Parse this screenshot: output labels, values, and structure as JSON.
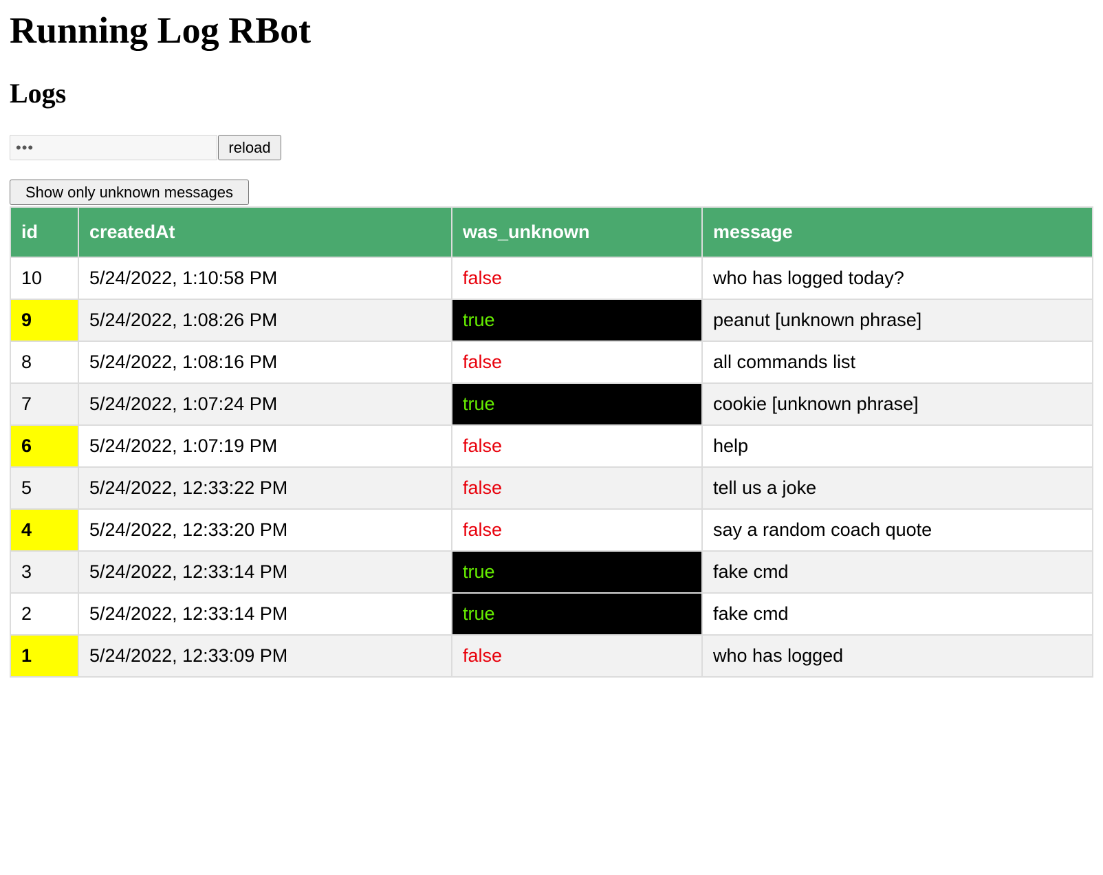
{
  "page": {
    "title": "Running Log RBot",
    "subtitle": "Logs"
  },
  "controls": {
    "password_value": "•••",
    "reload_label": "reload",
    "filter_label": "Show only unknown messages"
  },
  "colors": {
    "header_bg": "#4aa96e",
    "highlight_id_bg": "#ffff00",
    "unknown_true_bg": "#000000",
    "unknown_true_fg": "#66ee00",
    "unknown_false_fg": "#e8000b"
  },
  "table": {
    "columns": [
      "id",
      "createdAt",
      "was_unknown",
      "message"
    ],
    "rows": [
      {
        "id": "10",
        "createdAt": "5/24/2022, 1:10:58 PM",
        "was_unknown": "false",
        "message": "who has logged today?",
        "highlight": false
      },
      {
        "id": "9",
        "createdAt": "5/24/2022, 1:08:26 PM",
        "was_unknown": "true",
        "message": "peanut [unknown phrase]",
        "highlight": true
      },
      {
        "id": "8",
        "createdAt": "5/24/2022, 1:08:16 PM",
        "was_unknown": "false",
        "message": "all commands list",
        "highlight": false
      },
      {
        "id": "7",
        "createdAt": "5/24/2022, 1:07:24 PM",
        "was_unknown": "true",
        "message": "cookie [unknown phrase]",
        "highlight": false
      },
      {
        "id": "6",
        "createdAt": "5/24/2022, 1:07:19 PM",
        "was_unknown": "false",
        "message": "help",
        "highlight": true
      },
      {
        "id": "5",
        "createdAt": "5/24/2022, 12:33:22 PM",
        "was_unknown": "false",
        "message": "tell us a joke",
        "highlight": false
      },
      {
        "id": "4",
        "createdAt": "5/24/2022, 12:33:20 PM",
        "was_unknown": "false",
        "message": "say a random coach quote",
        "highlight": true
      },
      {
        "id": "3",
        "createdAt": "5/24/2022, 12:33:14 PM",
        "was_unknown": "true",
        "message": "fake cmd",
        "highlight": false
      },
      {
        "id": "2",
        "createdAt": "5/24/2022, 12:33:14 PM",
        "was_unknown": "true",
        "message": "fake cmd",
        "highlight": false
      },
      {
        "id": "1",
        "createdAt": "5/24/2022, 12:33:09 PM",
        "was_unknown": "false",
        "message": "who has logged",
        "highlight": true
      }
    ]
  }
}
